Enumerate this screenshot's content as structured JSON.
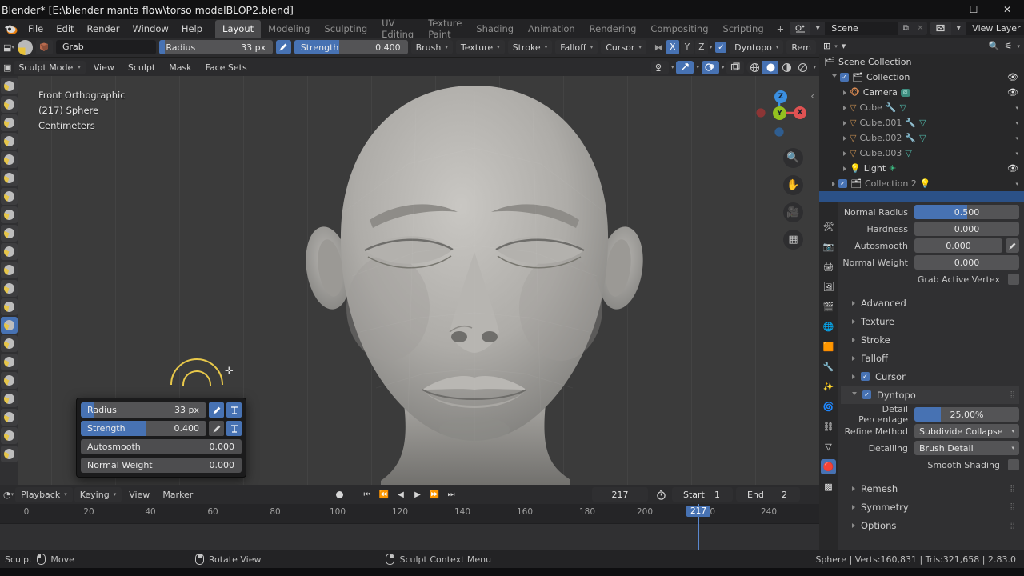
{
  "window": {
    "title": "Blender* [E:\\blender manta flow\\torso modelBLOP2.blend]",
    "minimize": "–",
    "maximize": "☐",
    "close": "✕"
  },
  "topbar": {
    "menus": [
      "File",
      "Edit",
      "Render",
      "Window",
      "Help"
    ],
    "workspaces": [
      {
        "label": "Layout",
        "active": true
      },
      {
        "label": "Modeling",
        "active": false
      },
      {
        "label": "Sculpting",
        "active": false
      },
      {
        "label": "UV Editing",
        "active": false
      },
      {
        "label": "Texture Paint",
        "active": false
      },
      {
        "label": "Shading",
        "active": false
      },
      {
        "label": "Animation",
        "active": false
      },
      {
        "label": "Rendering",
        "active": false
      },
      {
        "label": "Compositing",
        "active": false
      },
      {
        "label": "Scripting",
        "active": false
      }
    ],
    "add_workspace": "+",
    "scene": "Scene",
    "view_layer": "View Layer"
  },
  "tool_header": {
    "brush_name": "Grab",
    "radius_label": "Radius",
    "radius_value": "33 px",
    "radius_fill_pct": 4,
    "strength_label": "Strength",
    "strength_value": "0.400",
    "strength_fill_pct": 40,
    "menus": [
      "Brush",
      "Texture",
      "Stroke",
      "Falloff",
      "Cursor"
    ],
    "symmetry_axes": [
      {
        "label": "X",
        "on": true
      },
      {
        "label": "Y",
        "on": false
      },
      {
        "label": "Z",
        "on": false
      }
    ],
    "dyntopo_label": "Dyntopo",
    "dyntopo_enabled": true,
    "remesh_label": "Rem"
  },
  "viewport_header": {
    "mode": "Sculpt Mode",
    "menus": [
      "View",
      "Sculpt",
      "Mask",
      "Face Sets"
    ]
  },
  "viewport": {
    "view_name": "Front Orthographic",
    "object_name": "(217) Sphere",
    "units": "Centimeters",
    "gizmo_axes": [
      {
        "label": "Z",
        "color": "#3b8fe0"
      },
      {
        "label": "Y",
        "color": "#93c01f"
      },
      {
        "label": "X",
        "color": "#e05252"
      }
    ]
  },
  "brush_popup": {
    "rows": [
      {
        "label": "Radius",
        "value": "33 px",
        "fill_pct": 10,
        "has_icons": true
      },
      {
        "label": "Strength",
        "value": "0.400",
        "fill_pct": 52,
        "has_icons": true
      },
      {
        "label": "Autosmooth",
        "value": "0.000",
        "fill_pct": 0,
        "has_icons": false
      },
      {
        "label": "Normal Weight",
        "value": "0.000",
        "fill_pct": 0,
        "has_icons": false
      }
    ]
  },
  "outliner": {
    "root": "Scene Collection",
    "rows": [
      {
        "label": "Collection",
        "indent": 12,
        "checkbox": true,
        "icon": "collection-icon",
        "dim": false,
        "eye": true,
        "selected": false
      },
      {
        "label": "Camera",
        "indent": 26,
        "checkbox": false,
        "icon": "monkey-icon",
        "dim": false,
        "eye": true,
        "selected": false
      },
      {
        "label": "Cube",
        "indent": 26,
        "checkbox": false,
        "icon": "mesh-icon",
        "dim": true,
        "eye": false,
        "selected": false
      },
      {
        "label": "Cube.001",
        "indent": 26,
        "checkbox": false,
        "icon": "mesh-icon",
        "dim": true,
        "eye": false,
        "selected": false
      },
      {
        "label": "Cube.002",
        "indent": 26,
        "checkbox": false,
        "icon": "mesh-icon",
        "dim": true,
        "eye": false,
        "selected": false
      },
      {
        "label": "Cube.003",
        "indent": 26,
        "checkbox": false,
        "icon": "mesh-icon",
        "dim": true,
        "eye": false,
        "selected": false
      },
      {
        "label": "Light",
        "indent": 26,
        "checkbox": false,
        "icon": "light-icon",
        "dim": false,
        "eye": true,
        "selected": false
      },
      {
        "label": "Collection 2",
        "indent": 12,
        "checkbox": true,
        "icon": "collection-icon",
        "dim": true,
        "eye": false,
        "selected": false
      }
    ]
  },
  "properties": {
    "fields": [
      {
        "label": "Normal Radius",
        "value": "0.500",
        "fill_pct": 50,
        "edit": false
      },
      {
        "label": "Hardness",
        "value": "0.000",
        "fill_pct": 0,
        "edit": false
      },
      {
        "label": "Autosmooth",
        "value": "0.000",
        "fill_pct": 0,
        "edit": true
      },
      {
        "label": "Normal Weight",
        "value": "0.000",
        "fill_pct": 0,
        "edit": false
      }
    ],
    "grab_active_vertex": "Grab Active Vertex",
    "sections": [
      {
        "label": "Advanced",
        "open": false,
        "checkbox": false
      },
      {
        "label": "Texture",
        "open": false,
        "checkbox": false
      },
      {
        "label": "Stroke",
        "open": false,
        "checkbox": false
      },
      {
        "label": "Falloff",
        "open": false,
        "checkbox": false
      },
      {
        "label": "Cursor",
        "open": false,
        "checkbox": true
      }
    ],
    "dyntopo": {
      "title": "Dyntopo",
      "enabled": true,
      "detail_percentage_label": "Detail Percentage",
      "detail_percentage_value": "25.00%",
      "detail_percentage_fill": 25,
      "refine_method_label": "Refine Method",
      "refine_method_value": "Subdivide Collapse",
      "detailing_label": "Detailing",
      "detailing_value": "Brush Detail",
      "smooth_shading_label": "Smooth Shading"
    },
    "bottom_sections": [
      {
        "label": "Remesh"
      },
      {
        "label": "Symmetry"
      },
      {
        "label": "Options"
      }
    ]
  },
  "timeline": {
    "menus_drop": [
      "Playback",
      "Keying"
    ],
    "menus_flat": [
      "View",
      "Marker"
    ],
    "current_frame": "217",
    "start_label": "Start",
    "start_value": "1",
    "end_label": "End",
    "end_value": "2",
    "ruler_ticks": [
      "0",
      "20",
      "40",
      "60",
      "80",
      "100",
      "120",
      "140",
      "160",
      "180",
      "200",
      "220",
      "240"
    ],
    "playhead_label": "217"
  },
  "statusbar": {
    "items": [
      {
        "icon": "",
        "label": "Sculpt"
      },
      {
        "icon": "mouse-left-icon",
        "label": "Move"
      },
      {
        "icon": "mouse-middle-icon",
        "label": "Rotate View"
      },
      {
        "icon": "mouse-right-icon",
        "label": "Sculpt Context Menu"
      }
    ],
    "stats": "Sphere | Verts:160,831 | Tris:321,658 | 2.83.0"
  },
  "colors": {
    "accent": "#4772b3",
    "panel": "#303032",
    "header": "#2b2b2d",
    "viewport": "#3b3b3b",
    "cursor_ring": "#e8c84a"
  }
}
